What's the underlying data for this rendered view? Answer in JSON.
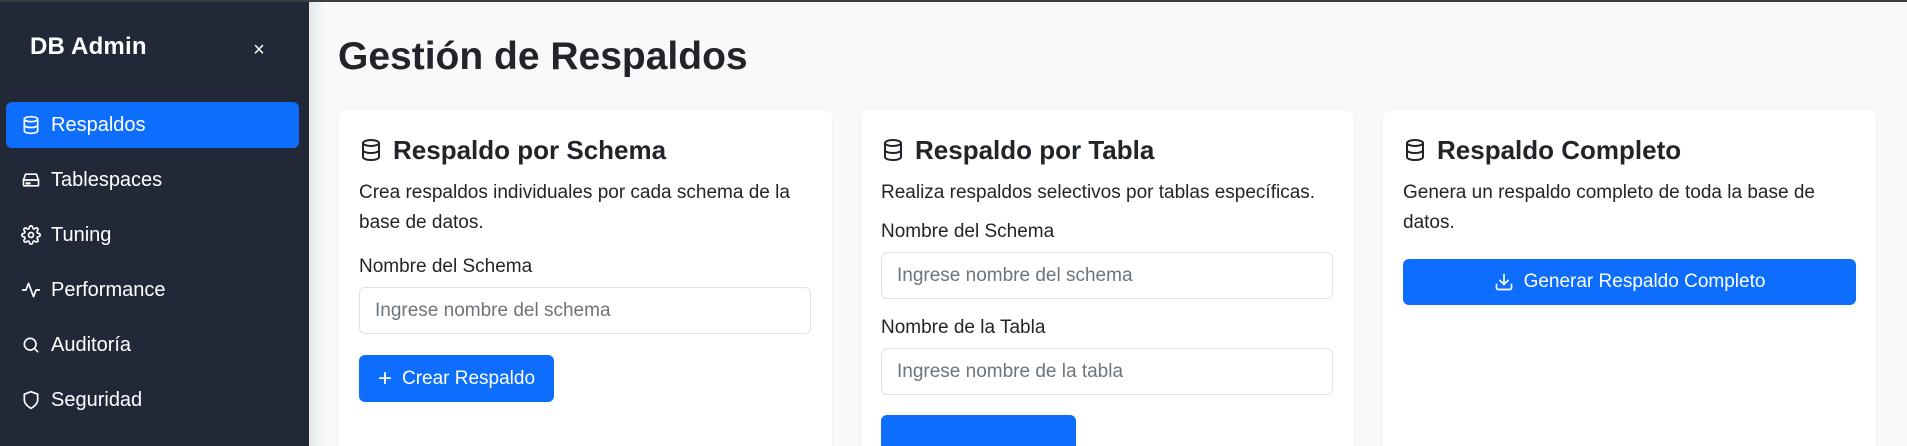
{
  "sidebar": {
    "brand": "DB Admin",
    "close_label": "×",
    "items": [
      {
        "label": "Respaldos",
        "icon": "database-icon",
        "active": true
      },
      {
        "label": "Tablespaces",
        "icon": "hard-drive-icon",
        "active": false
      },
      {
        "label": "Tuning",
        "icon": "gear-icon",
        "active": false
      },
      {
        "label": "Performance",
        "icon": "activity-icon",
        "active": false
      },
      {
        "label": "Auditoría",
        "icon": "search-icon",
        "active": false
      },
      {
        "label": "Seguridad",
        "icon": "shield-icon",
        "active": false
      }
    ]
  },
  "main": {
    "title": "Gestión de Respaldos",
    "cards": {
      "schema": {
        "title": "Respaldo por Schema",
        "description": "Crea respaldos individuales por cada schema de la base de datos.",
        "field_label": "Nombre del Schema",
        "field_placeholder": "Ingrese nombre del schema",
        "field_value": "",
        "button_label": "Crear Respaldo"
      },
      "table": {
        "title": "Respaldo por Tabla",
        "description": "Realiza respaldos selectivos por tablas específicas.",
        "schema_label": "Nombre del Schema",
        "schema_placeholder": "Ingrese nombre del schema",
        "schema_value": "",
        "table_label": "Nombre de la Tabla",
        "table_placeholder": "Ingrese nombre de la tabla",
        "table_value": ""
      },
      "full": {
        "title": "Respaldo Completo",
        "description": "Genera un respaldo completo de toda la base de datos.",
        "button_label": "Generar Respaldo Completo"
      }
    }
  },
  "colors": {
    "sidebar_bg": "#212938",
    "accent": "#0d6efd",
    "page_bg": "#f8f9fa"
  }
}
